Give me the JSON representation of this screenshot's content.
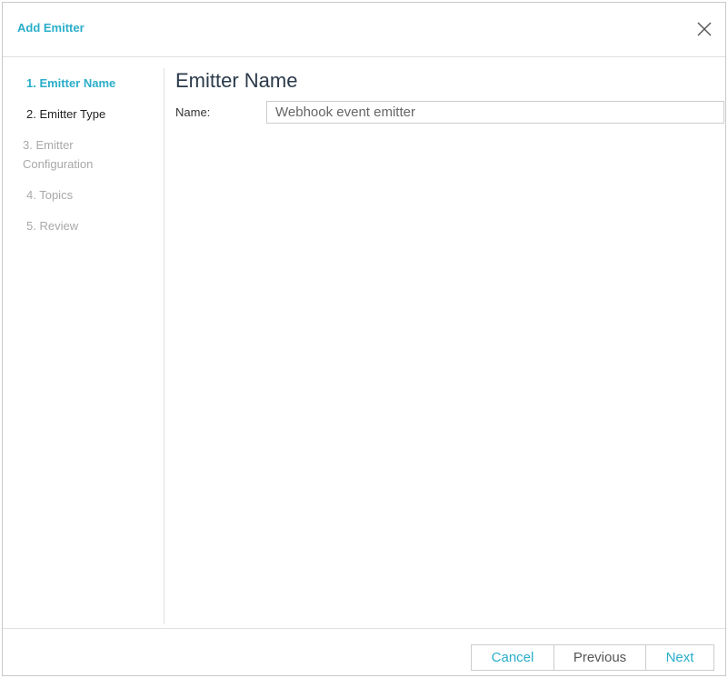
{
  "dialog": {
    "title": "Add Emitter",
    "close_icon": "close-icon"
  },
  "steps": [
    {
      "label": "1. Emitter Name",
      "state": "active"
    },
    {
      "label": "2. Emitter Type",
      "state": "enabled"
    },
    {
      "label": "3. Emitter Configuration",
      "state": "disabled"
    },
    {
      "label": "4. Topics",
      "state": "disabled"
    },
    {
      "label": "5. Review",
      "state": "disabled"
    }
  ],
  "content": {
    "title": "Emitter Name",
    "name_label": "Name:",
    "name_value": "Webhook event emitter"
  },
  "footer": {
    "cancel_label": "Cancel",
    "previous_label": "Previous",
    "next_label": "Next"
  },
  "colors": {
    "accent": "#2aaec9",
    "heading": "#2b3a4a",
    "disabled": "#a8a8a8",
    "border": "#cccccc"
  }
}
